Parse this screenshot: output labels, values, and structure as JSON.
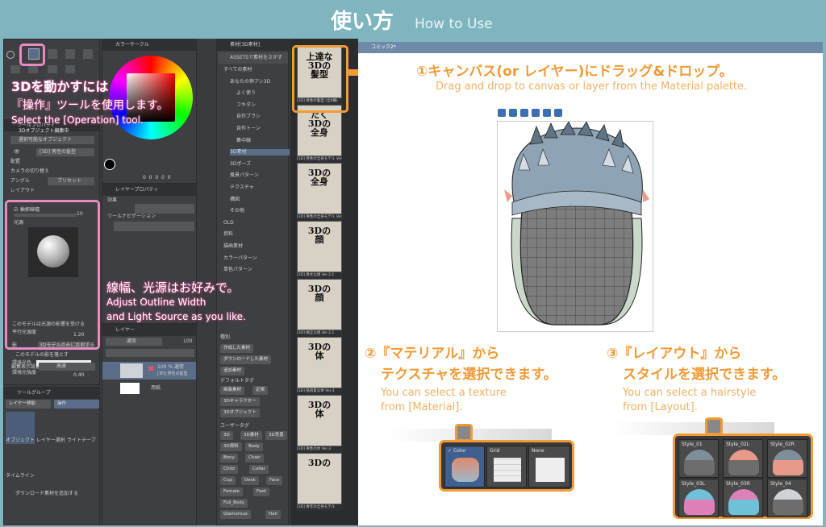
{
  "banner": {
    "title": "使い方",
    "subtitle": "How to Use"
  },
  "app": {
    "color_wheel_title": "カラーサークル",
    "op_tab_title": "ツールプロパティ",
    "op_header": "3Dオブジェクト編集中",
    "sel_option": "選択可能なオブジェクト",
    "model_name": "[3D] 男性の髪型",
    "layout_rows": [
      "配置",
      "カメラの切り替え",
      "アングル",
      "レイアウト"
    ],
    "angle_value": "プリセット",
    "outline_label": "輪郭線幅",
    "outline_value": "10",
    "light_label": "光源",
    "light_rows": [
      "このモデルは光源の影響を受ける",
      "平行光源度",
      "影",
      "このモデルの影を落とす",
      "環境光色",
      "環境光強度"
    ],
    "parallel_value": "1.20",
    "shadow_option": "3Dモデルのみに反射する",
    "ambient_value": "0.40",
    "display_quality_label": "編集表示設定",
    "display_quality_value": "高速",
    "tool_group_title": "ツールグループ",
    "tool_tabs": [
      "レイヤー移動",
      "操作"
    ],
    "tool_items": [
      "オブジェクト",
      "レイヤー選択",
      "ライトテーブ"
    ],
    "timeline": "タイムライン",
    "add_material": "ダウンロード素材を追加する",
    "effect_label": "効果",
    "navigation_label": "ツールナビゲーション",
    "layer_prop_title": "レイヤープロパティ",
    "layer_title": "レイヤー",
    "layer_blend": "通常",
    "layer_opacity": "100",
    "layer_row1_a": "100 % 通常",
    "layer_row1_b": "[3D] 男性の髪型",
    "layer_row2": "用紙",
    "color_values": [
      "0",
      "0",
      "0",
      "0",
      "0"
    ],
    "material_title": "素材[3D素材]",
    "assets_banner": "ASSETSで素材をさがす",
    "tree": [
      {
        "label": "すべての素材",
        "indent": 0
      },
      {
        "label": "あなたの神アシ3D",
        "indent": 1
      },
      {
        "label": "よく使う",
        "indent": 2
      },
      {
        "label": "フキダシ",
        "indent": 2
      },
      {
        "label": "自作ブラシ",
        "indent": 2
      },
      {
        "label": "自作トーン",
        "indent": 2
      },
      {
        "label": "集中線",
        "indent": 2
      },
      {
        "label": "3D素材",
        "indent": 1
      },
      {
        "label": "3Dポーズ",
        "indent": 1
      },
      {
        "label": "風景パターン",
        "indent": 1
      },
      {
        "label": "テクスチャ",
        "indent": 1
      },
      {
        "label": "構図",
        "indent": 1
      },
      {
        "label": "その他",
        "indent": 1
      },
      {
        "label": "OLD",
        "indent": 0
      },
      {
        "label": "資料",
        "indent": 0
      },
      {
        "label": "描画素材",
        "indent": 0
      },
      {
        "label": "カラーパターン",
        "indent": 0
      },
      {
        "label": "単色パターン",
        "indent": 0
      }
    ],
    "tag_header1": "種別",
    "tag_type_rows": [
      "作成した素材",
      "ダウンロードした素材",
      "追加素材"
    ],
    "tag_header2": "デフォルトタグ",
    "tag_default": [
      "画像素材",
      "定規",
      "3Dキャラクター",
      "3Dオブジェクト"
    ],
    "tag_header3": "ユーザータグ",
    "tag_user": [
      "3D",
      "3D素材",
      "3D背景",
      "3D資料",
      "Body",
      "Bony",
      "Chair",
      "Child",
      "Collar",
      "Cup",
      "Desk",
      "Face",
      "Female",
      "Foot",
      "Full_Body",
      "Glamorous",
      "Hair"
    ],
    "thumbs": [
      {
        "text": "上達な\n3Dの\n髪型",
        "cap": "[3D] 男性の髪型 (全6種)",
        "size": "small"
      },
      {
        "text": "たく\n3Dの\n全身",
        "cap": "[3D] 男性の全身モデル Ver.",
        "size": "small"
      },
      {
        "text": "3Dの\n全身",
        "cap": "[3D] 男性の全身モデル Ver.",
        "size": "small"
      },
      {
        "text": "3Dの\n顔",
        "cap": "[3D] 骨太な顔 Ver.2.1",
        "size": "small"
      },
      {
        "text": "3Dの\n顔",
        "cap": "[3D] 端正な顔 Ver.2.1",
        "size": "small"
      },
      {
        "text": "3Dの\n体",
        "cap": "[3D] 筋肉質な体 Ver.3",
        "size": "small"
      },
      {
        "text": "3Dの\n体",
        "cap": "[3D] 男性の体 Ver.3",
        "size": "small"
      },
      {
        "text": "3Dの",
        "cap": "[3D] 青年の全身モデル",
        "size": "small"
      }
    ]
  },
  "overlay": {
    "step0_title": "3Dを動かすには",
    "step0_jp": "『操作』ツールを使用します。",
    "step0_en": "Select the [Operation] tool.",
    "outline_jp": "線幅、光源はお好みで。",
    "outline_en1": "Adjust Outline Width",
    "outline_en2": "and Light Source as you like."
  },
  "canvas": {
    "tab": "コミック2*",
    "step1_title": "①キャンバス(or レイヤー)にドラッグ&ドロップ。",
    "step1_en": "Drag and drop to canvas or layer from the Material palette.",
    "step2_title1": "②『マテリアル』から",
    "step2_title2": "テクスチャを選択できます。",
    "step2_en1": "You can select a texture",
    "step2_en2": "from [Material].",
    "step3_title1": "③『レイアウト』から",
    "step3_title2": "スタイルを選択できます。",
    "step3_en1": "You can select a hairstyle",
    "step3_en2": "from [Layout].",
    "materials": [
      "Color",
      "Grid",
      "None"
    ],
    "styles": [
      "Style_01",
      "Style_02L",
      "Style_02R",
      "Style_03L",
      "Style_03R",
      "Style_04"
    ]
  },
  "colors": {
    "accent": "#f29a36",
    "banner": "#7fb5bf",
    "pink": "#e98bc0"
  }
}
